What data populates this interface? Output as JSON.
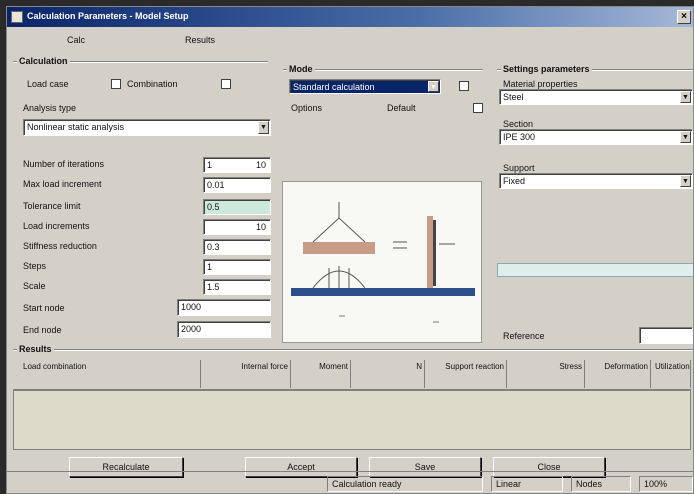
{
  "window": {
    "title": "Calculation Parameters - Model Setup"
  },
  "tabs": [
    "Calc",
    "Results"
  ],
  "left": {
    "group_title": "Calculation",
    "option_a": "Load case",
    "option_b": "Combination",
    "analysis_label": "Analysis type",
    "analysis_value": "Nonlinear static analysis",
    "params": [
      {
        "label": "Number of iterations",
        "value": "1",
        "unit": "10"
      },
      {
        "label": "Max load increment",
        "value": "0.01",
        "unit": ""
      },
      {
        "label": "Tolerance limit",
        "value": "0.5",
        "unit": ""
      },
      {
        "label": "Load increments",
        "value": "",
        "unit": "10"
      },
      {
        "label": "Stiffness reduction",
        "value": "0.3",
        "unit": ""
      },
      {
        "label": "Steps",
        "value": "1",
        "unit": ""
      },
      {
        "label": "Scale",
        "value": "1.5",
        "unit": ""
      }
    ],
    "from_label": "Start node",
    "from_value": "1000",
    "to_label": "End node",
    "to_value": "2000"
  },
  "middle": {
    "group_title": "Mode",
    "mode_value": "Standard calculation",
    "sub_label": "Options",
    "sub_value": "Default"
  },
  "right": {
    "group_title": "Settings parameters",
    "f1_label": "Material properties",
    "f1_value": "Steel",
    "f2_label": "Section",
    "f2_value": "IPE 300",
    "f3_label": "Support",
    "f3_value": "Fixed",
    "bottom_label": "Reference",
    "bottom_value": ""
  },
  "results": {
    "title": "Results",
    "columns": [
      "Load combination",
      "Internal force",
      "Moment",
      "N",
      "Support reaction",
      "Stress",
      "Deformation",
      "Utilization"
    ]
  },
  "buttons": [
    "Recalculate",
    "Accept",
    "Save",
    "Close"
  ],
  "status": [
    "Calculation ready",
    "Linear",
    "Nodes",
    "100%"
  ]
}
